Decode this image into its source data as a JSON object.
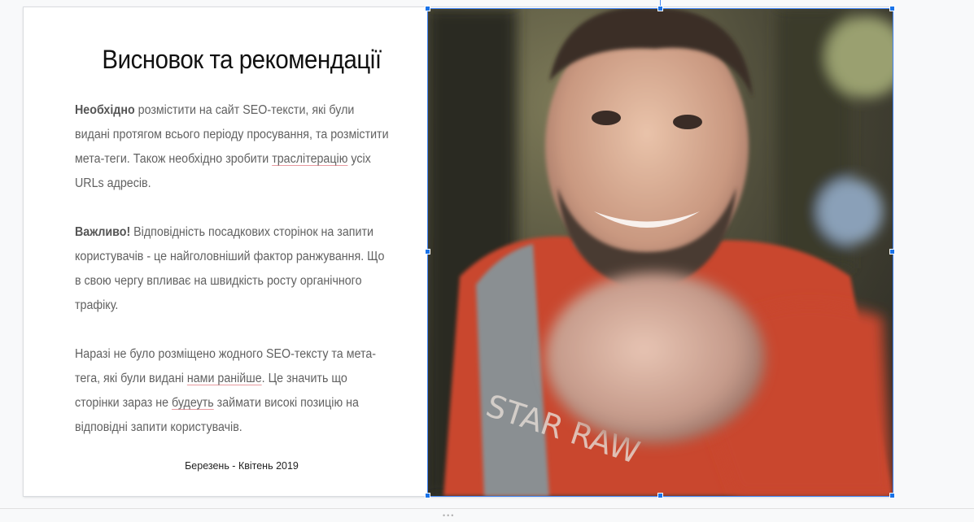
{
  "slide": {
    "title": "Висновок та рекомендації",
    "paragraph1": {
      "bold": "Необхідно",
      "text1": " розмістити на сайт SEO-тексти, які були видані протягом всього періоду просування, та розмістити мета-теги. Також необхідно зробити ",
      "underlined": "траслітерацію",
      "text2": " усіх URLs адресів."
    },
    "paragraph2": {
      "bold": "Важливо!",
      "text": " Відповідність посадкових сторінок на запити користувачів - це найголовніший фактор ранжування. Що в свою чергу впливає на швидкість росту органічного трафіку."
    },
    "paragraph3": {
      "text1": "Наразі не було розміщено жодного SEO-тексту та мета-тега, які були видані ",
      "underlined1": "нами ранійше",
      "text2": ". Це значить що сторінки зараз не ",
      "underlined2": "будеуть",
      "text3": " займати високі позицію на відповідні запити користувачів."
    },
    "footer": "Березень - Квітень 2019",
    "photo": {
      "description_icon": "person-pointing-photo",
      "shirt_text": "STAR RAW"
    }
  },
  "colors": {
    "selection": "#4285f4",
    "handle": "#1a73e8",
    "body_text": "#616161",
    "shirt": "#c9472e"
  }
}
